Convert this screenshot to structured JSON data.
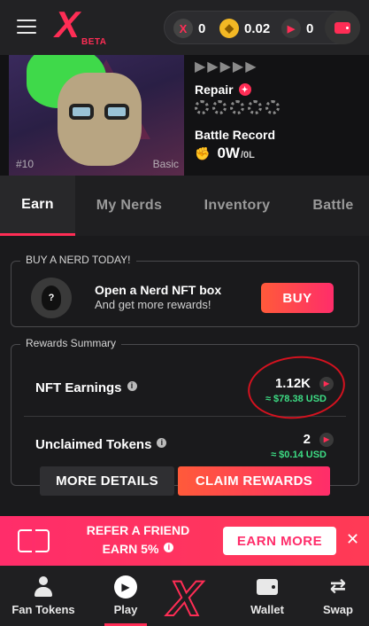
{
  "header": {
    "logo": "X",
    "logo_badge": "BETA",
    "balances": {
      "x_token": "0",
      "bnb": "0.02",
      "play": "0"
    }
  },
  "nerd_card": {
    "image_id": "#10",
    "rarity": "Basic",
    "arrows": "▶▶▶▶▶",
    "repair_label": "Repair",
    "battle_label": "Battle Record",
    "battle_wins": "0W",
    "battle_losses": "/0L"
  },
  "tabs": [
    {
      "label": "Earn",
      "active": true
    },
    {
      "label": "My Nerds",
      "active": false
    },
    {
      "label": "Inventory",
      "active": false
    },
    {
      "label": "Battle",
      "active": false
    }
  ],
  "buy_section": {
    "title": "BUY A NERD TODAY!",
    "headline": "Open a Nerd NFT box",
    "subline": "And get more rewards!",
    "button": "BUY",
    "avatar_glyph": "?"
  },
  "rewards": {
    "title": "Rewards Summary",
    "nft_earnings_label": "NFT Earnings",
    "nft_earnings_value": "1.12K",
    "nft_earnings_usd": "≈ $78.38 USD",
    "unclaimed_label": "Unclaimed Tokens",
    "unclaimed_value": "2",
    "unclaimed_usd": "≈ $0.14 USD",
    "more_details": "MORE DETAILS",
    "claim_rewards": "CLAIM REWARDS"
  },
  "refer": {
    "line1": "REFER A FRIEND",
    "line2": "EARN 5%",
    "button": "EARN MORE",
    "close": "✕"
  },
  "bottom_nav": [
    {
      "label": "Fan Tokens",
      "icon": "person-icon"
    },
    {
      "label": "Play",
      "icon": "play-icon",
      "active": true
    },
    {
      "label": "",
      "icon": "x-logo-icon"
    },
    {
      "label": "Wallet",
      "icon": "wallet-icon"
    },
    {
      "label": "Swap",
      "icon": "swap-icon"
    }
  ],
  "colors": {
    "accent": "#ff2d55",
    "usd_green": "#3ddc84",
    "background": "#1a1a1c"
  }
}
